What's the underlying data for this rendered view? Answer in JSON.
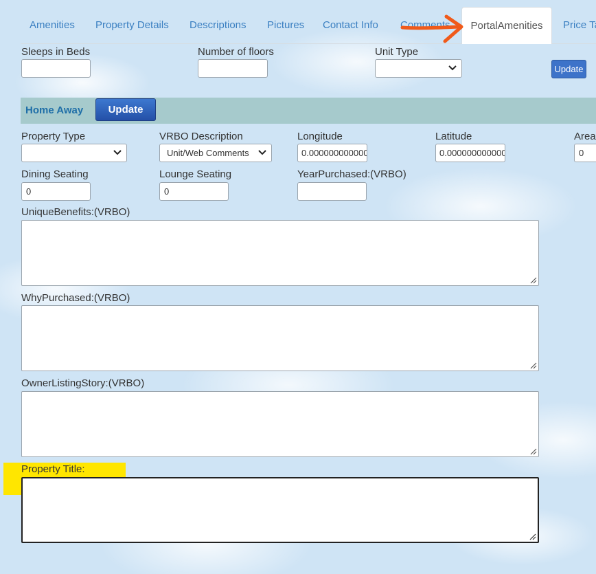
{
  "tabs": [
    {
      "label": "Amenities"
    },
    {
      "label": "Property Details"
    },
    {
      "label": "Descriptions"
    },
    {
      "label": "Pictures"
    },
    {
      "label": "Contact Info"
    },
    {
      "label": "Comments"
    },
    {
      "label": "PortalAmenities"
    },
    {
      "label": "Price Ta"
    }
  ],
  "top_form": {
    "sleeps_label": "Sleeps in Beds",
    "floors_label": "Number of floors",
    "unit_type_label": "Unit Type",
    "update_label": "Update"
  },
  "home_away": {
    "title": "Home Away",
    "update_label": "Update"
  },
  "fields": {
    "property_type_label": "Property Type",
    "vrbo_desc_label": "VRBO Description",
    "vrbo_desc_value": "Unit/Web Comments",
    "longitude_label": "Longitude",
    "longitude_value": "0.000000000000",
    "latitude_label": "Latitude",
    "latitude_value": "0.000000000000",
    "area_label": "Area",
    "area_value": "0",
    "dining_label": "Dining Seating",
    "dining_value": "0",
    "lounge_label": "Lounge Seating",
    "lounge_value": "0",
    "year_label": "YearPurchased:(VRBO)",
    "unique_label": "UniqueBenefits:(VRBO)",
    "why_label": "WhyPurchased:(VRBO)",
    "owner_label": "OwnerListingStory:(VRBO)",
    "title_label": "Property Title:"
  },
  "colors": {
    "tab_text": "#3a7fc1",
    "annotation_arrow": "#f05a1a",
    "highlight": "#ffe600",
    "home_away_bar": "#a6cacc"
  }
}
